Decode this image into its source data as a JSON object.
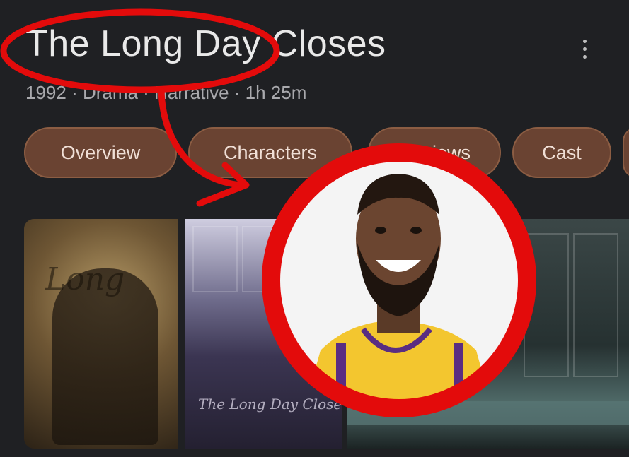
{
  "movie": {
    "title": "The Long Day Closes",
    "meta": "1992 · Drama · Narrative · 1h 25m"
  },
  "tabs": [
    {
      "label": "Overview"
    },
    {
      "label": "Characters"
    },
    {
      "label": "Reviews"
    },
    {
      "label": "Cast"
    }
  ],
  "poster": {
    "script_text": "The Long Day Closes"
  },
  "colors": {
    "annotation_red": "#e30b0b",
    "tab_fill": "#6a4332",
    "background": "#1f2023"
  },
  "icons": {
    "menu": "vertical-ellipsis-icon"
  }
}
